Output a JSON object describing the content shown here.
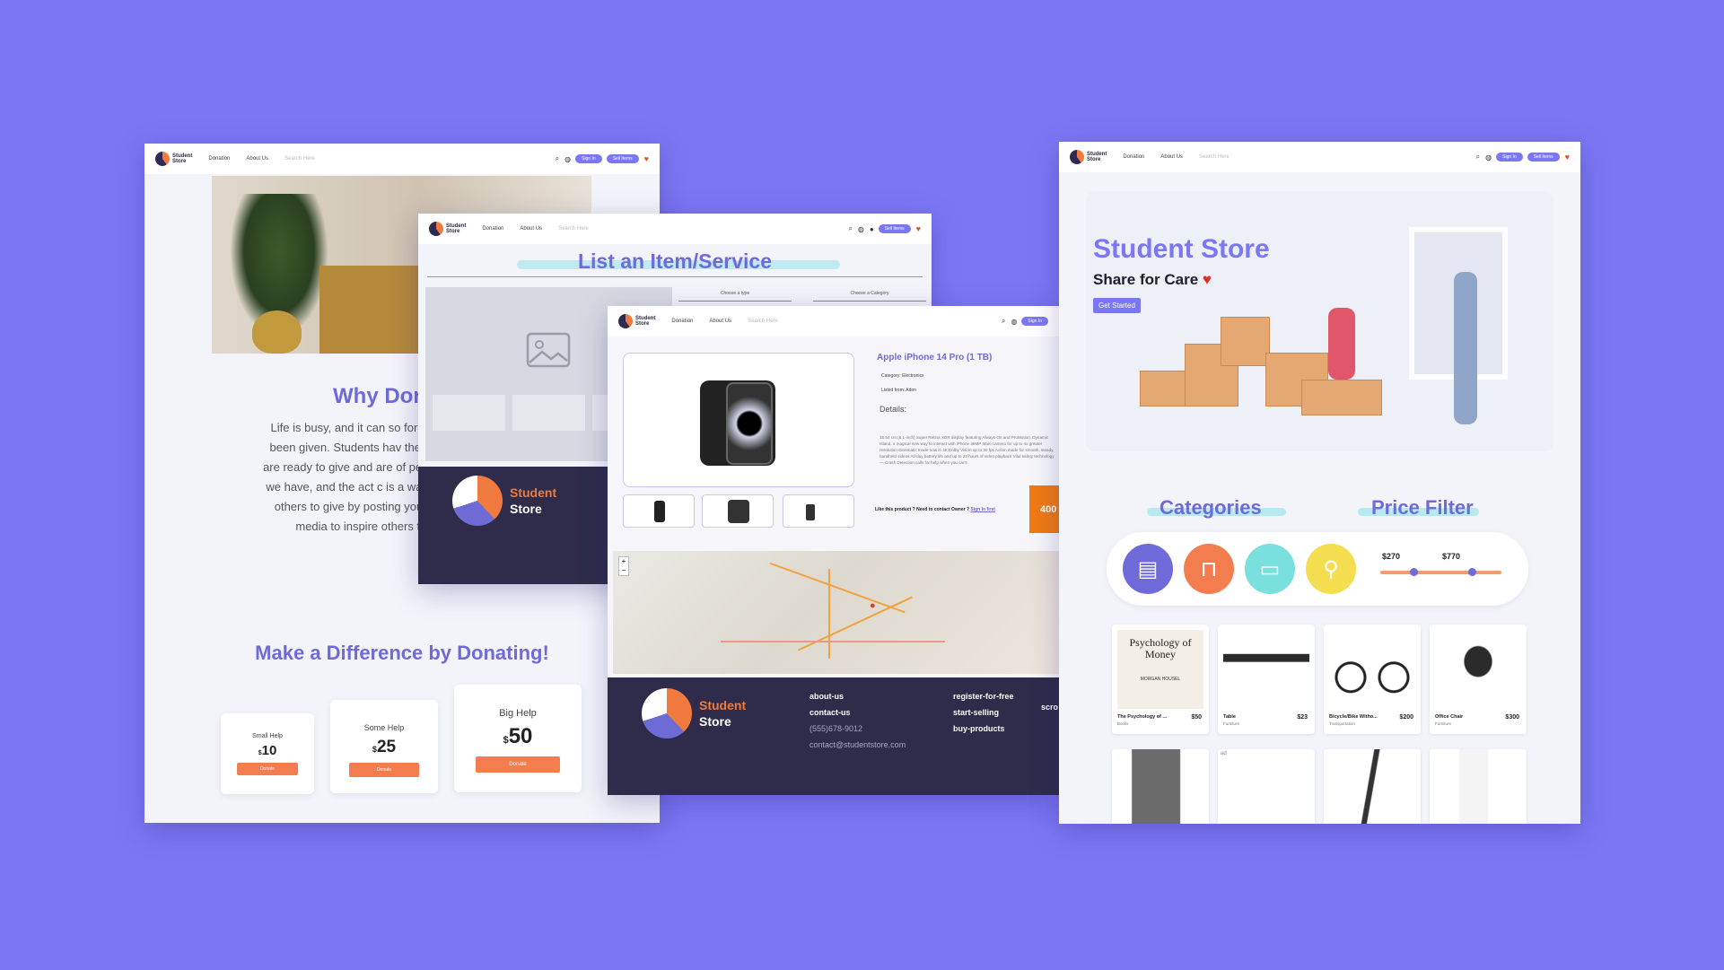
{
  "nav": {
    "logo_line1": "Student",
    "logo_line2": "Store",
    "donation": "Donation",
    "about": "About Us",
    "search_placeholder": "Search Here",
    "sign_in": "Sign In",
    "sell_items": "Sell Items"
  },
  "donate_page": {
    "heading": "Why Dor",
    "paragraph": "Life is busy, and it can so forget to show your gratitu been given. Students hav they're in need of financial are ready to give and are of people to support, this that we have, and the act c is a way to express our Inspire others to give by posting your kind action on social media to inspire others to give generously.",
    "cta": "Make a Difference by Donating!",
    "cards": [
      {
        "label": "Small Help",
        "currency": "$",
        "amount": "10",
        "button": "Donate"
      },
      {
        "label": "Some Help",
        "currency": "$",
        "amount": "25",
        "button": "Donate"
      },
      {
        "label": "Big Help",
        "currency": "$",
        "amount": "50",
        "button": "Donate"
      }
    ]
  },
  "list_page": {
    "title": "List an Item/Service",
    "type_select": "Choose a type",
    "category_select": "Choose a Category",
    "footer_logo1": "Student",
    "footer_logo2": "Store"
  },
  "product_page": {
    "title": "Apple iPhone 14 Pro (1 TB)",
    "category": "Category: Electronics",
    "listed_from": "Listed from: Aden",
    "details_label": "Details:",
    "description": "15.54 cm (6.1-inch) Super Retina XDR display featuring Always-On and ProMotion, Dynamic Island, a magical new way to interact with iPhone 48MP Main camera for up to 4x greater resolution Cinematic mode now in 4K Dolby Vision up to 30 fps Action mode for smooth, steady, handheld videos All-day battery life and up to 23 hours of video playback Vital safety technology — Crash Detection calls for help when you can't",
    "owner_text": "Like this product ? Need to contact Owner ?",
    "owner_link": "Sign In first",
    "price": "400",
    "footer_logo1": "Student",
    "footer_logo2": "Store",
    "footer_col1": [
      "about-us",
      "contact-us",
      "(555)678-9012",
      "contact@studentstore.com"
    ],
    "footer_col2": [
      "register-for-free",
      "start-selling",
      "buy-products"
    ],
    "footer_col3": "scro"
  },
  "home_page": {
    "title": "Student Store",
    "subtitle": "Share for Care",
    "get_started": "Get Started",
    "categories": "Categories",
    "price_filter": "Price Filter",
    "range_min": "$270",
    "range_max": "$770",
    "products": [
      {
        "name": "The Psychology of ...",
        "cat": "Books",
        "price": "$50"
      },
      {
        "name": "Table",
        "cat": "Furniture",
        "price": "$23"
      },
      {
        "name": "Bicycle/Bike Witho...",
        "cat": "Transportation",
        "price": "$200"
      },
      {
        "name": "Office Chair",
        "cat": "Furniture",
        "price": "$300"
      }
    ],
    "book_cover": "Psychology of Money",
    "book_author": "MORGAN HOUSEL",
    "broken_img": "ad"
  },
  "colors": {
    "background": "#7b77f4",
    "accent": "#6f6ad9",
    "orange": "#f47d4f",
    "footer": "#2e2c4a"
  }
}
